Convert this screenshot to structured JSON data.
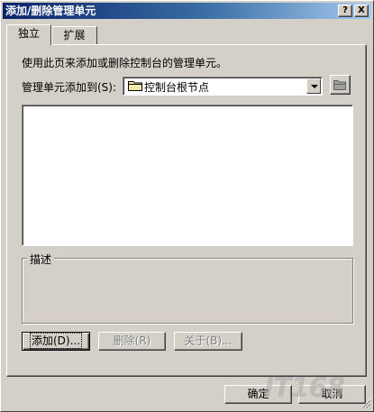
{
  "window": {
    "title": "添加/删除管理单元",
    "help_label": "?",
    "close_label": "X"
  },
  "tabs": [
    {
      "label": "独立",
      "selected": true
    },
    {
      "label": "扩展",
      "selected": false
    }
  ],
  "panel": {
    "description": "使用此页来添加或删除控制台的管理单元。",
    "add_to_label": "管理单元添加到(S):",
    "add_to_value": "控制台根节点",
    "group_label": "描述",
    "buttons": {
      "add": "添加(D)...",
      "remove": "删除(R)",
      "about": "关于(B)..."
    }
  },
  "footer": {
    "ok": "确定",
    "cancel": "取消"
  },
  "watermark": "IT168",
  "colors": {
    "face": "#d4d0c8",
    "title_start": "#0a246a",
    "title_end": "#a6caf0"
  }
}
